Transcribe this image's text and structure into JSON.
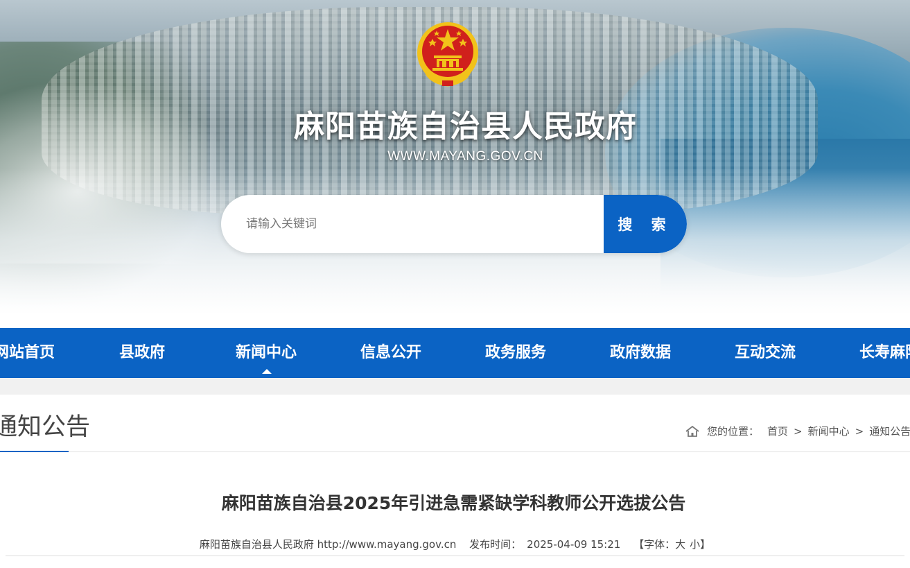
{
  "header": {
    "site_title": "麻阳苗族自治县人民政府",
    "site_url": "WWW.MAYANG.GOV.CN",
    "emblem_icon": "national-emblem-icon"
  },
  "search": {
    "placeholder": "请输入关键词",
    "value": "",
    "button_label": "搜 索"
  },
  "nav": {
    "items": [
      {
        "label": "网站首页"
      },
      {
        "label": "县政府"
      },
      {
        "label": "新闻中心",
        "active": true
      },
      {
        "label": "信息公开"
      },
      {
        "label": "政务服务"
      },
      {
        "label": "政府数据"
      },
      {
        "label": "互动交流"
      },
      {
        "label": "长寿麻阳"
      }
    ]
  },
  "section": {
    "title": "通知公告"
  },
  "breadcrumb": {
    "label": "您的位置：",
    "items": [
      "首页",
      "新闻中心",
      "通知公告"
    ],
    "separator": ">",
    "home_icon": "home-icon"
  },
  "article": {
    "title": "麻阳苗族自治县2025年引进急需紧缺学科教师公开选拔公告",
    "source": "麻阳苗族自治县人民政府 http://www.mayang.gov.cn",
    "published_label": "发布时间：",
    "published_time": "2025-04-09 15:21",
    "font_label": "【字体：",
    "font_large": "大",
    "font_small": "小",
    "font_close": "】"
  },
  "colors": {
    "brand_blue": "#0b63c4",
    "emblem_red": "#d0201c",
    "emblem_gold": "#f2c21a"
  }
}
